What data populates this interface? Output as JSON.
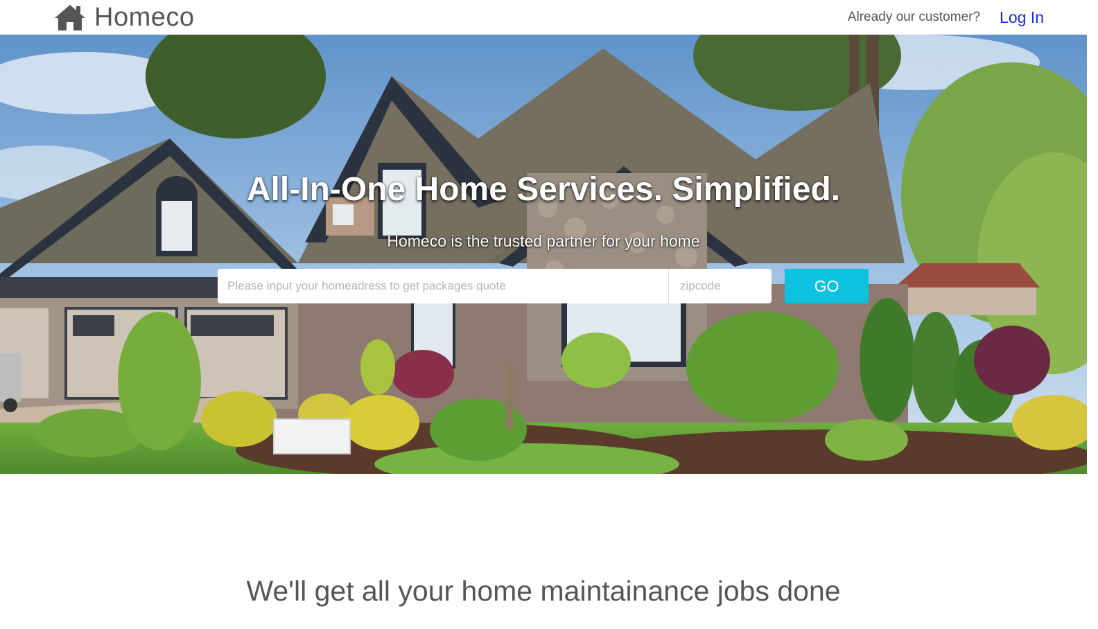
{
  "brand": {
    "name": "Homeco",
    "icon": "house-icon"
  },
  "nav": {
    "question": "Already our customer?",
    "login_label": "Log In",
    "login_color": "#1a2bd9"
  },
  "hero": {
    "title": "All-In-One Home Services. Simplified.",
    "subtitle": "Homeco is the trusted partner for your home",
    "background": "photo of a large suburban house with landscaped garden"
  },
  "search": {
    "address_placeholder": "Please input your homeadress to get packages quote",
    "zip_placeholder": "zipcode",
    "go_label": "GO",
    "go_color": "#0cc2df"
  },
  "section": {
    "heading": "We'll get all your home maintainance jobs done"
  }
}
